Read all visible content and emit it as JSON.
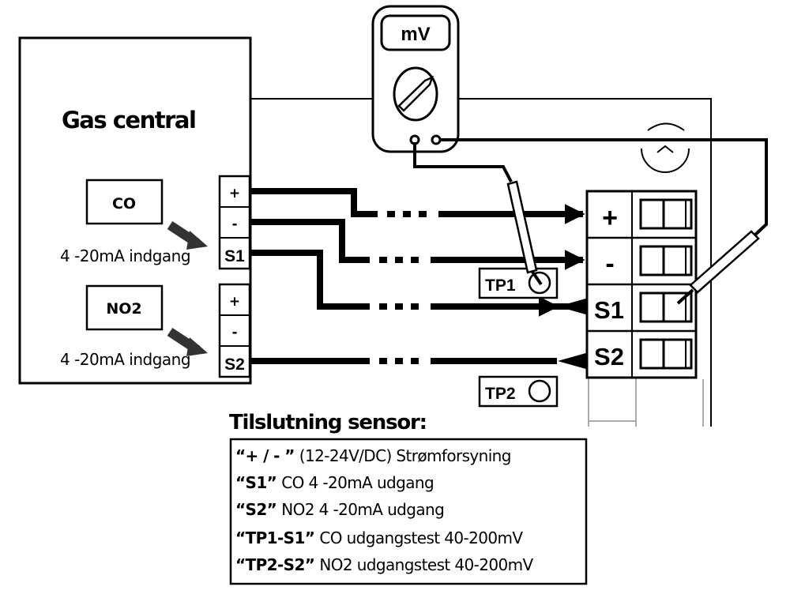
{
  "gas_central": {
    "title": "Gas central",
    "channels": [
      {
        "sensor": "CO",
        "input_label": "4 -20mA indgang",
        "terminals": [
          "+",
          "-",
          "S1"
        ]
      },
      {
        "sensor": "NO2",
        "input_label": "4 -20mA indgang",
        "terminals": [
          "+",
          "-",
          "S2"
        ]
      }
    ]
  },
  "multimeter": {
    "display": "mV"
  },
  "sensor": {
    "terminals": [
      "+",
      "-",
      "S1",
      "S2"
    ],
    "test_points": [
      "TP1",
      "TP2"
    ]
  },
  "legend": {
    "title": "Tilslutning sensor:",
    "rows": [
      {
        "key": "“+ / - ”",
        "text": "(12-24V/DC) Strømforsyning"
      },
      {
        "key": "“S1”",
        "text": "CO 4 -20mA udgang"
      },
      {
        "key": "“S2”",
        "text": "NO2 4 -20mA udgang"
      },
      {
        "key": "“TP1-S1”",
        "text": "CO udgangstest 40-200mV"
      },
      {
        "key": "“TP2-S2”",
        "text": "NO2 udgangstest 40-200mV"
      }
    ]
  }
}
